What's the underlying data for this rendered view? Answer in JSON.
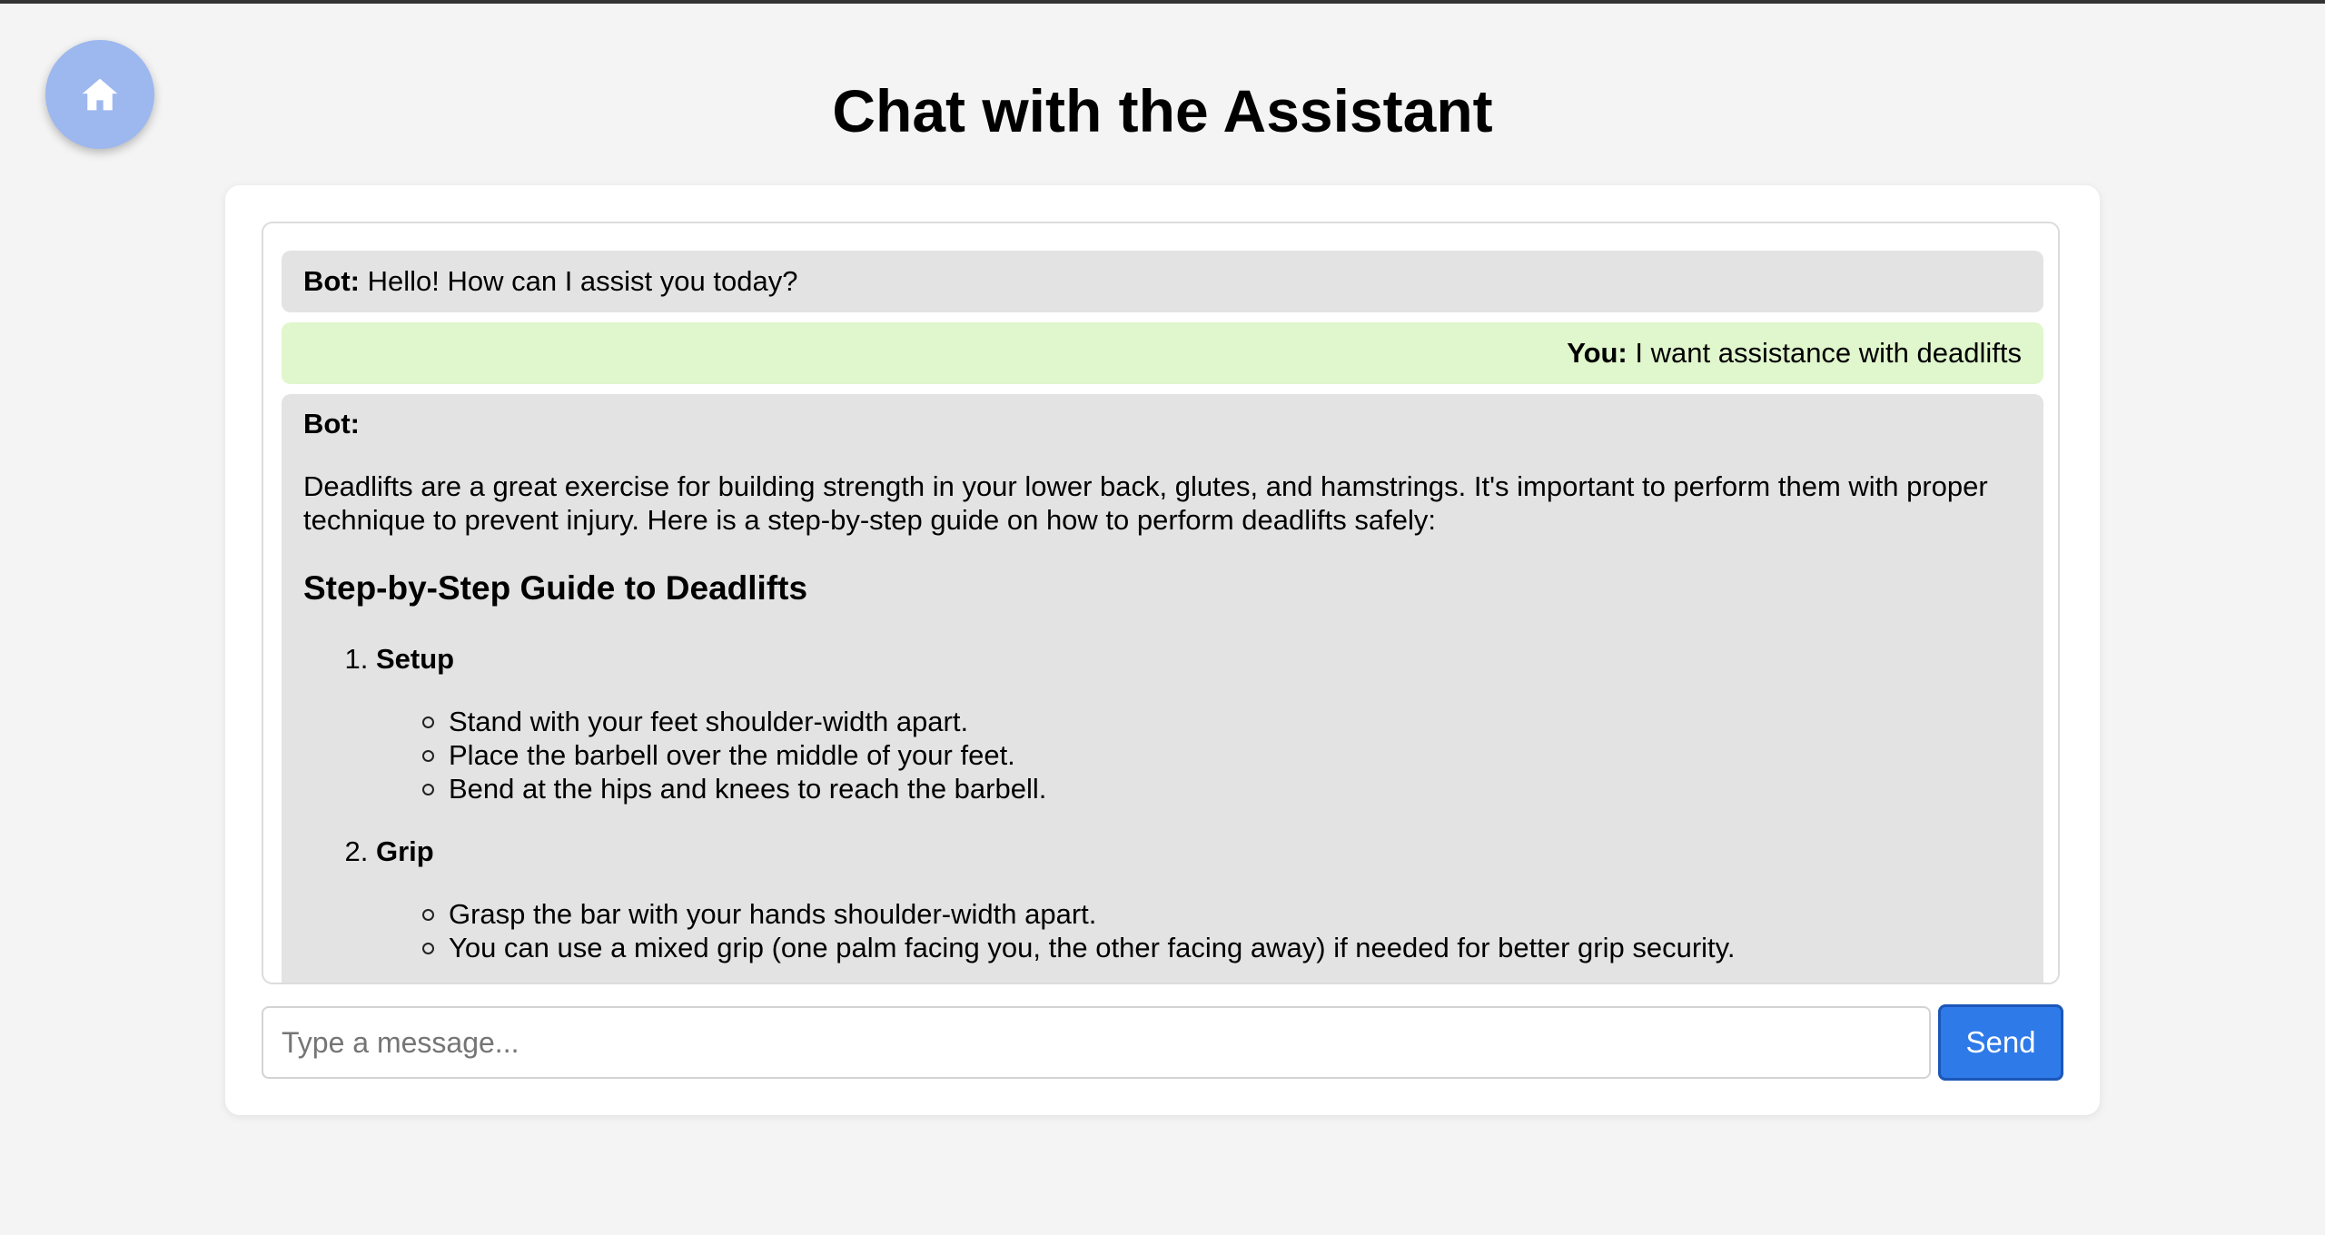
{
  "header": {
    "title": "Chat with the Assistant",
    "home_icon": "home-icon"
  },
  "colors": {
    "accent": "#2f7ae9",
    "home_button": "#9db7ef",
    "bot_bubble": "#e3e3e3",
    "user_bubble": "#e0f6cc"
  },
  "messages": {
    "m1": {
      "sender": "Bot:",
      "text": "Hello! How can I assist you today?"
    },
    "m2": {
      "sender": "You:",
      "text": "I want assistance with deadlifts"
    },
    "m3": {
      "sender": "Bot:",
      "intro": "Deadlifts are a great exercise for building strength in your lower back, glutes, and hamstrings. It's important to perform them with proper technique to prevent injury. Here is a step-by-step guide on how to perform deadlifts safely:",
      "heading": "Step-by-Step Guide to Deadlifts",
      "steps": [
        {
          "title": "Setup",
          "items": [
            "Stand with your feet shoulder-width apart.",
            "Place the barbell over the middle of your feet.",
            "Bend at the hips and knees to reach the barbell."
          ]
        },
        {
          "title": "Grip",
          "items": [
            "Grasp the bar with your hands shoulder-width apart.",
            "You can use a mixed grip (one palm facing you, the other facing away) if needed for better grip security."
          ]
        }
      ]
    }
  },
  "composer": {
    "placeholder": "Type a message...",
    "send_label": "Send"
  }
}
